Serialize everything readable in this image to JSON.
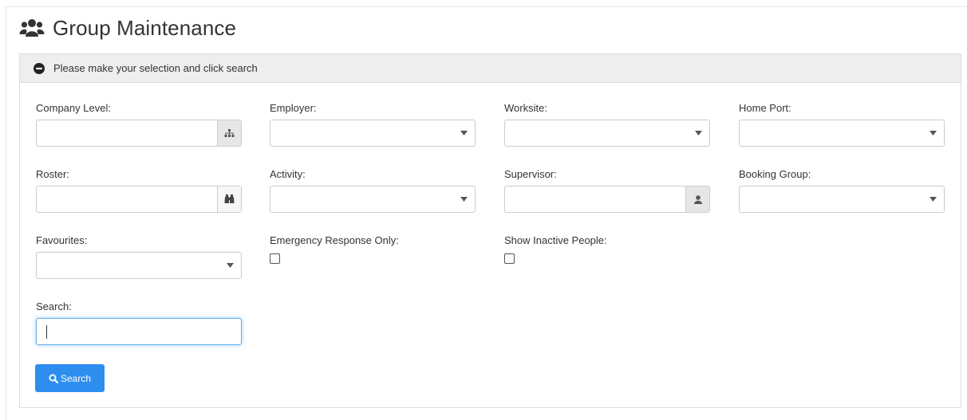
{
  "header": {
    "title": "Group Maintenance",
    "icon": "users-icon"
  },
  "panel": {
    "heading": "Please make your selection and click search",
    "toggle_icon": "minus-circle-icon"
  },
  "fields": {
    "company_level": {
      "label": "Company Level:",
      "value": "",
      "addon_icon": "sitemap-icon"
    },
    "employer": {
      "label": "Employer:",
      "value": ""
    },
    "worksite": {
      "label": "Worksite:",
      "value": ""
    },
    "home_port": {
      "label": "Home Port:",
      "value": ""
    },
    "roster": {
      "label": "Roster:",
      "value": "",
      "addon_icon": "binoculars-icon"
    },
    "activity": {
      "label": "Activity:",
      "value": ""
    },
    "supervisor": {
      "label": "Supervisor:",
      "value": "",
      "addon_icon": "user-icon"
    },
    "booking_group": {
      "label": "Booking Group:",
      "value": ""
    },
    "favourites": {
      "label": "Favourites:",
      "value": ""
    },
    "emergency_response_only": {
      "label": "Emergency Response Only:",
      "checked": false
    },
    "show_inactive_people": {
      "label": "Show Inactive People:",
      "checked": false
    },
    "search": {
      "label": "Search:",
      "value": ""
    }
  },
  "search_button": {
    "label": "Search",
    "icon": "search-icon"
  },
  "colors": {
    "primary": "#2e8ef0",
    "focus": "#66afe9",
    "panel_heading_bg": "#eeeeee"
  }
}
